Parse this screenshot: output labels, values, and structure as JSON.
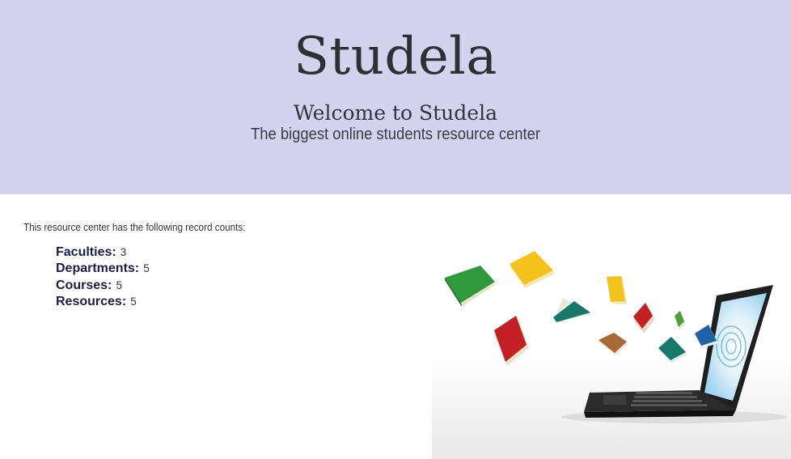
{
  "hero": {
    "brand": "Studela",
    "welcome": "Welcome to Studela",
    "tagline": "The biggest online students resource center"
  },
  "records": {
    "intro": "This resource center has the following record counts:",
    "items": [
      {
        "label": "Faculties:",
        "value": "3"
      },
      {
        "label": "Departments:",
        "value": "5"
      },
      {
        "label": "Courses:",
        "value": "5"
      },
      {
        "label": "Resources:",
        "value": "5"
      }
    ]
  },
  "colors": {
    "hero_bg": "#d3d3ee",
    "label_color": "#1b1d4a"
  },
  "illustration": {
    "icon": "laptop-with-flying-books-icon"
  }
}
